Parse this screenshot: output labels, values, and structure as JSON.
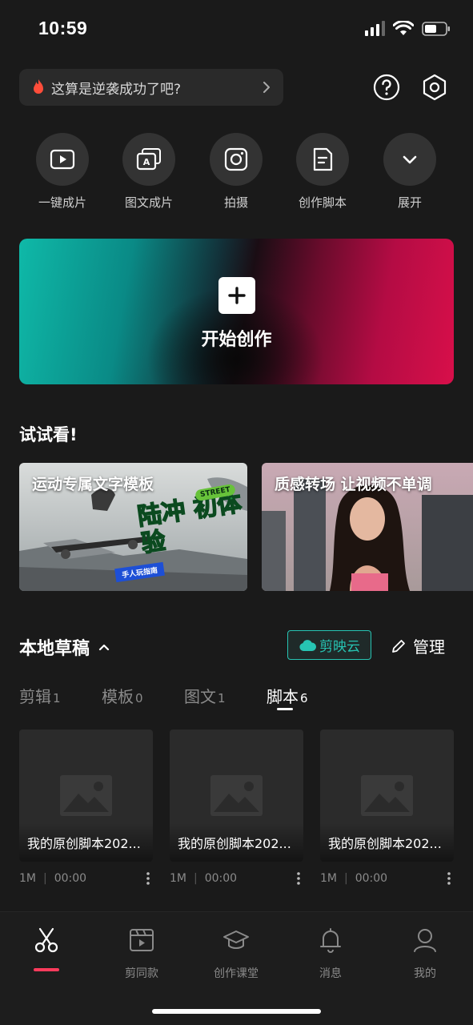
{
  "status_bar": {
    "time": "10:59"
  },
  "search": {
    "text": "这算是逆袭成功了吧?"
  },
  "quick_actions": [
    {
      "label": "一键成片",
      "icon": "play-square-icon"
    },
    {
      "label": "图文成片",
      "icon": "text-to-video-icon"
    },
    {
      "label": "拍摄",
      "icon": "camera-icon"
    },
    {
      "label": "创作脚本",
      "icon": "script-doc-icon"
    },
    {
      "label": "展开",
      "icon": "chevron-down-icon"
    }
  ],
  "hero": {
    "label": "开始创作"
  },
  "try_section": {
    "title": "试试看!",
    "cards": [
      {
        "title": "运动专属文字模板",
        "overlay_text": "陆冲 初体验",
        "overlay_sub": "手人玩指南",
        "badge": "STREET"
      },
      {
        "title": "质感转场 让视频不单调"
      }
    ]
  },
  "drafts": {
    "title": "本地草稿",
    "cloud_label": "剪映云",
    "manage_label": "管理",
    "tabs": [
      {
        "label": "剪辑",
        "count": "1"
      },
      {
        "label": "模板",
        "count": "0"
      },
      {
        "label": "图文",
        "count": "1"
      },
      {
        "label": "脚本",
        "count": "6"
      }
    ],
    "active_tab": 3,
    "items": [
      {
        "name": "我的原创脚本202...",
        "size": "1M",
        "duration": "00:00"
      },
      {
        "name": "我的原创脚本202...",
        "size": "1M",
        "duration": "00:00"
      },
      {
        "name": "我的原创脚本202...",
        "size": "1M",
        "duration": "00:00"
      }
    ]
  },
  "bottom_nav": [
    {
      "label": "",
      "icon": "scissors-icon"
    },
    {
      "label": "剪同款",
      "icon": "clapper-icon"
    },
    {
      "label": "创作课堂",
      "icon": "graduation-cap-icon"
    },
    {
      "label": "消息",
      "icon": "bell-icon"
    },
    {
      "label": "我的",
      "icon": "user-icon"
    }
  ],
  "colors": {
    "accent_teal": "#27c4b3",
    "accent_red": "#ff3b5c",
    "background": "#1a1a1a"
  }
}
